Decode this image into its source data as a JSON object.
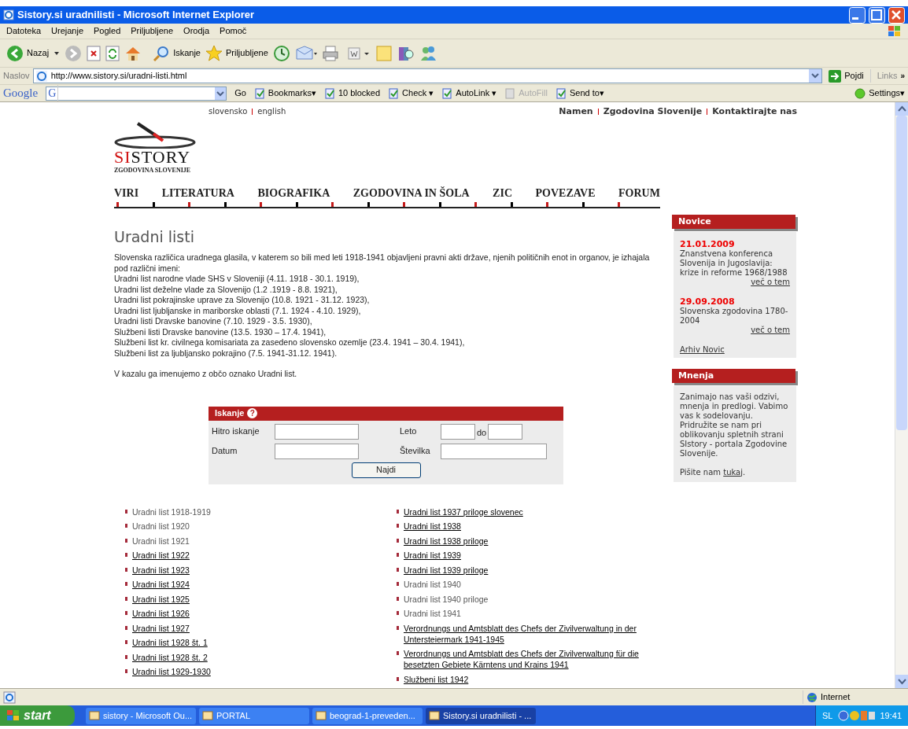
{
  "window": {
    "title": "Sistory.si uradnilisti - Microsoft Internet Explorer"
  },
  "menu": [
    "Datoteka",
    "Urejanje",
    "Pogled",
    "Priljubljene",
    "Orodja",
    "Pomoč"
  ],
  "toolbar": {
    "back": "Nazaj",
    "search": "Iskanje",
    "favorites": "Priljubljene"
  },
  "address": {
    "label": "Naslov",
    "value": "http://www.sistory.si/uradni-listi.html",
    "go": "Pojdi",
    "links": "Links",
    "more": "»"
  },
  "google_bar": [
    {
      "kind": "logo",
      "label": "Google"
    },
    {
      "kind": "field",
      "label": "G"
    },
    {
      "kind": "button",
      "label": "Go",
      "disabled": false
    },
    {
      "kind": "button",
      "label": "Bookmarks▾",
      "disabled": false
    },
    {
      "kind": "button",
      "label": "10 blocked",
      "disabled": false
    },
    {
      "kind": "button",
      "label": "Check ▾",
      "disabled": false
    },
    {
      "kind": "button",
      "label": "AutoLink ▾",
      "disabled": false
    },
    {
      "kind": "button",
      "label": "AutoFill",
      "disabled": true
    },
    {
      "kind": "button",
      "label": "Send to▾",
      "disabled": false
    },
    {
      "kind": "settings",
      "label": "Settings▾"
    }
  ],
  "site": {
    "languages": [
      "slovensko",
      "english"
    ],
    "top_links": [
      "Namen",
      "Zgodovina Slovenije",
      "Kontaktirajte nas"
    ],
    "logo": {
      "accent": "SI",
      "rest": "STORY",
      "tagline": "ZGODOVINA SLOVENIJE"
    },
    "nav": [
      "VIRI",
      "LITERATURA",
      "BIOGRAFIKA",
      "ZGODOVINA IN ŠOLA",
      "ZIC",
      "POVEZAVE",
      "FORUM"
    ]
  },
  "page": {
    "heading": "Uradni listi",
    "intro": [
      "Slovenska različica uradnega glasila, v katerem so bili med leti 1918-1941 objavljeni pravni akti države, njenih političnih enot in organov, je izhajala pod različni imeni:",
      "Uradni list narodne vlade SHS v Sloveniji (4.11. 1918 - 30.1. 1919),",
      "Uradni list deželne vlade za Slovenijo (1.2 .1919 - 8.8. 1921),",
      "Uradni list pokrajinske uprave za Slovenijo (10.8. 1921 - 31.12. 1923),",
      "Uradni list ljubljanske in mariborske oblasti (7.1. 1924 - 4.10. 1929),",
      "Uradni listi Dravske banovine (7.10. 1929 - 3.5. 1930),",
      "Službeni listi Dravske banovine (13.5. 1930 – 17.4. 1941),",
      "Službeni list kr. civilnega komisariata za zasedeno slovensko ozemlje (23.4. 1941 – 30.4. 1941),",
      "Službeni list za ljubljansko pokrajino (7.5. 1941-31.12. 1941)."
    ],
    "note": "V kazalu ga imenujemo z občo oznako Uradni list."
  },
  "search": {
    "title": "Iskanje",
    "help": "?",
    "quick": "Hitro iskanje",
    "year": "Leto",
    "to": "do",
    "date": "Datum",
    "number": "Številka",
    "button": "Najdi"
  },
  "lists": [
    [
      {
        "label": "Uradni list 1918-1919",
        "linked": false
      },
      {
        "label": "Uradni list 1920",
        "linked": false
      },
      {
        "label": "Uradni list 1921",
        "linked": false
      },
      {
        "label": "Uradni list 1922",
        "linked": true
      },
      {
        "label": "Uradni list 1923",
        "linked": true
      },
      {
        "label": "Uradni list 1924",
        "linked": true
      },
      {
        "label": "Uradni list 1925",
        "linked": true
      },
      {
        "label": "Uradni list 1926",
        "linked": true
      },
      {
        "label": "Uradni list 1927",
        "linked": true
      },
      {
        "label": "Uradni list 1928 št. 1",
        "linked": true
      },
      {
        "label": "Uradni list 1928 št. 2",
        "linked": true
      },
      {
        "label": "Uradni list 1929-1930",
        "linked": true
      }
    ],
    [
      {
        "label": "Uradni list 1937 priloge slovenec",
        "linked": true
      },
      {
        "label": "Uradni list 1938",
        "linked": true
      },
      {
        "label": "Uradni list 1938 priloge",
        "linked": true
      },
      {
        "label": "Uradni list 1939",
        "linked": true
      },
      {
        "label": "Uradni list 1939 priloge",
        "linked": true
      },
      {
        "label": "Uradni list 1940",
        "linked": false
      },
      {
        "label": "Uradni list 1940 priloge",
        "linked": false
      },
      {
        "label": "Uradni list 1941",
        "linked": false
      },
      {
        "label": "Verordnungs und Amtsblatt des Chefs der Zivilverwaltung in der Untersteiermark 1941-1945",
        "linked": true
      },
      {
        "label": "Verordnungs und Amtsblatt des Chefs der Zivilverwaltung für die besetzten Gebiete Kärntens und Krains 1941",
        "linked": true
      },
      {
        "label": "Službeni list 1942",
        "linked": true
      }
    ]
  ],
  "sidebar": {
    "news": {
      "title": "Novice",
      "items": [
        {
          "date": "21.01.2009",
          "text": "Znanstvena konferenca Slovenija in Jugoslavija: krize in reforme 1968/1988",
          "more": "več o tem"
        },
        {
          "date": "29.09.2008",
          "text": "Slovenska zgodovina 1780-2004",
          "more": "več o tem"
        }
      ],
      "archive": "Arhiv Novic"
    },
    "opinions": {
      "title": "Mnenja",
      "text": "Zanimajo nas vaši odzivi, mnenja in predlogi. Vabimo vas k sodelovanju. Pridružite se nam pri oblikovanju spletnih strani SIstory - portala Zgodovine Slovenije.",
      "write": "Pišite nam",
      "link": "tukaj",
      "end": "."
    }
  },
  "status_bar": {
    "zone": "Internet"
  },
  "taskbar": {
    "start": "start",
    "tasks": [
      {
        "label": "sistory - Microsoft Ou...",
        "selected": false
      },
      {
        "label": "PORTAL",
        "selected": false
      },
      {
        "label": "beograd-1-preveden...",
        "selected": false
      },
      {
        "label": "Sistory.si uradnilisti - ...",
        "selected": true
      }
    ],
    "language": "SL",
    "clock": "19:41"
  }
}
